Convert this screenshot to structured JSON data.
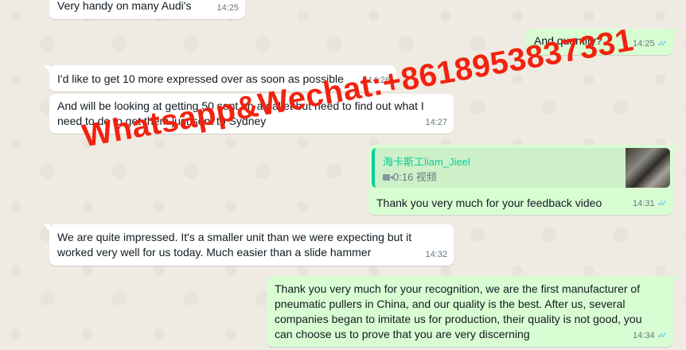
{
  "messages": [
    {
      "dir": "in",
      "text": "Very handy on many Audi's",
      "time": "14:25"
    },
    {
      "dir": "out",
      "text": "And quantity?",
      "time": "14:25"
    },
    {
      "dir": "in",
      "text": "I'd like to get 10 more expressed over as soon as possible",
      "time": "14:26"
    },
    {
      "dir": "in",
      "text": "And will be looking at getting 50 sent on a pallet but need to find out what I need to do to get them just sent to Sydney",
      "time": "14:27"
    },
    {
      "dir": "out",
      "text": "Thank you very much for your feedback video",
      "time": "14:31",
      "quote": {
        "author": "海卡斯工liam_Jieel",
        "subtitle": "0:16 视频"
      }
    },
    {
      "dir": "in",
      "text": "We are quite impressed. It's a smaller unit than we were expecting but it worked very well for us today. Much easier than a slide hammer",
      "time": "14:32"
    },
    {
      "dir": "out",
      "text": "Thank you very much for your recognition, we are the first manufacturer of pneumatic pullers in China, and our quality is the best. After us, several companies began to imitate us for production, their quality is not good, you can choose us to prove that you are very discerning",
      "time": "14:34"
    }
  ],
  "watermark": "Whatsapp&Wechat:+8618953837331",
  "colors": {
    "background": "#efeae2",
    "incoming": "#ffffff",
    "outgoing": "#d9fdd3",
    "read_tick": "#53bdeb",
    "quote_accent": "#06cf9c",
    "watermark": "#f2220f"
  },
  "icons": {
    "read_receipt": "double-check-icon",
    "video": "video-icon"
  }
}
